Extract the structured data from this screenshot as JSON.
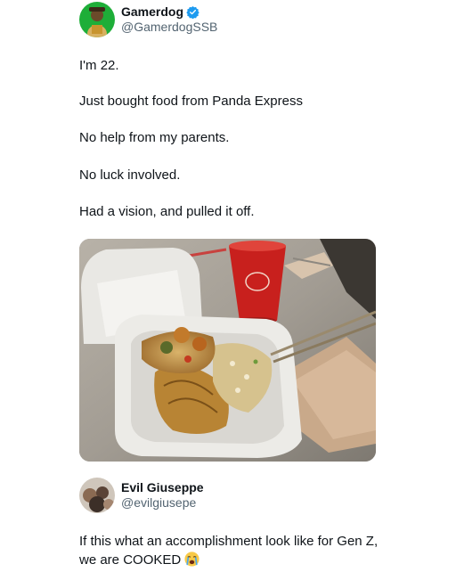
{
  "post": {
    "author": {
      "display_name": "Gamerdog",
      "handle": "@GamerdogSSB",
      "verified": true,
      "avatar_icon": "profile-avatar",
      "avatar_bg": "#1eae38"
    },
    "lines": [
      "I'm 22.",
      "Just bought food from Panda Express",
      "No help from my parents.",
      "No luck involved.",
      "Had a vision, and pulled it off."
    ],
    "photo": {
      "icon": "food-photo"
    }
  },
  "reply": {
    "author": {
      "display_name": "Evil Giuseppe",
      "handle": "@evilgiusepe",
      "avatar_icon": "profile-avatar"
    },
    "text": "If this what an accomplishment look like for Gen Z, we are COOKED",
    "emoji_icon": "loudly-crying-face-icon"
  },
  "colors": {
    "verified_badge": "#1d9bf0",
    "handle_text": "#536471",
    "body_text": "#0f1419"
  }
}
